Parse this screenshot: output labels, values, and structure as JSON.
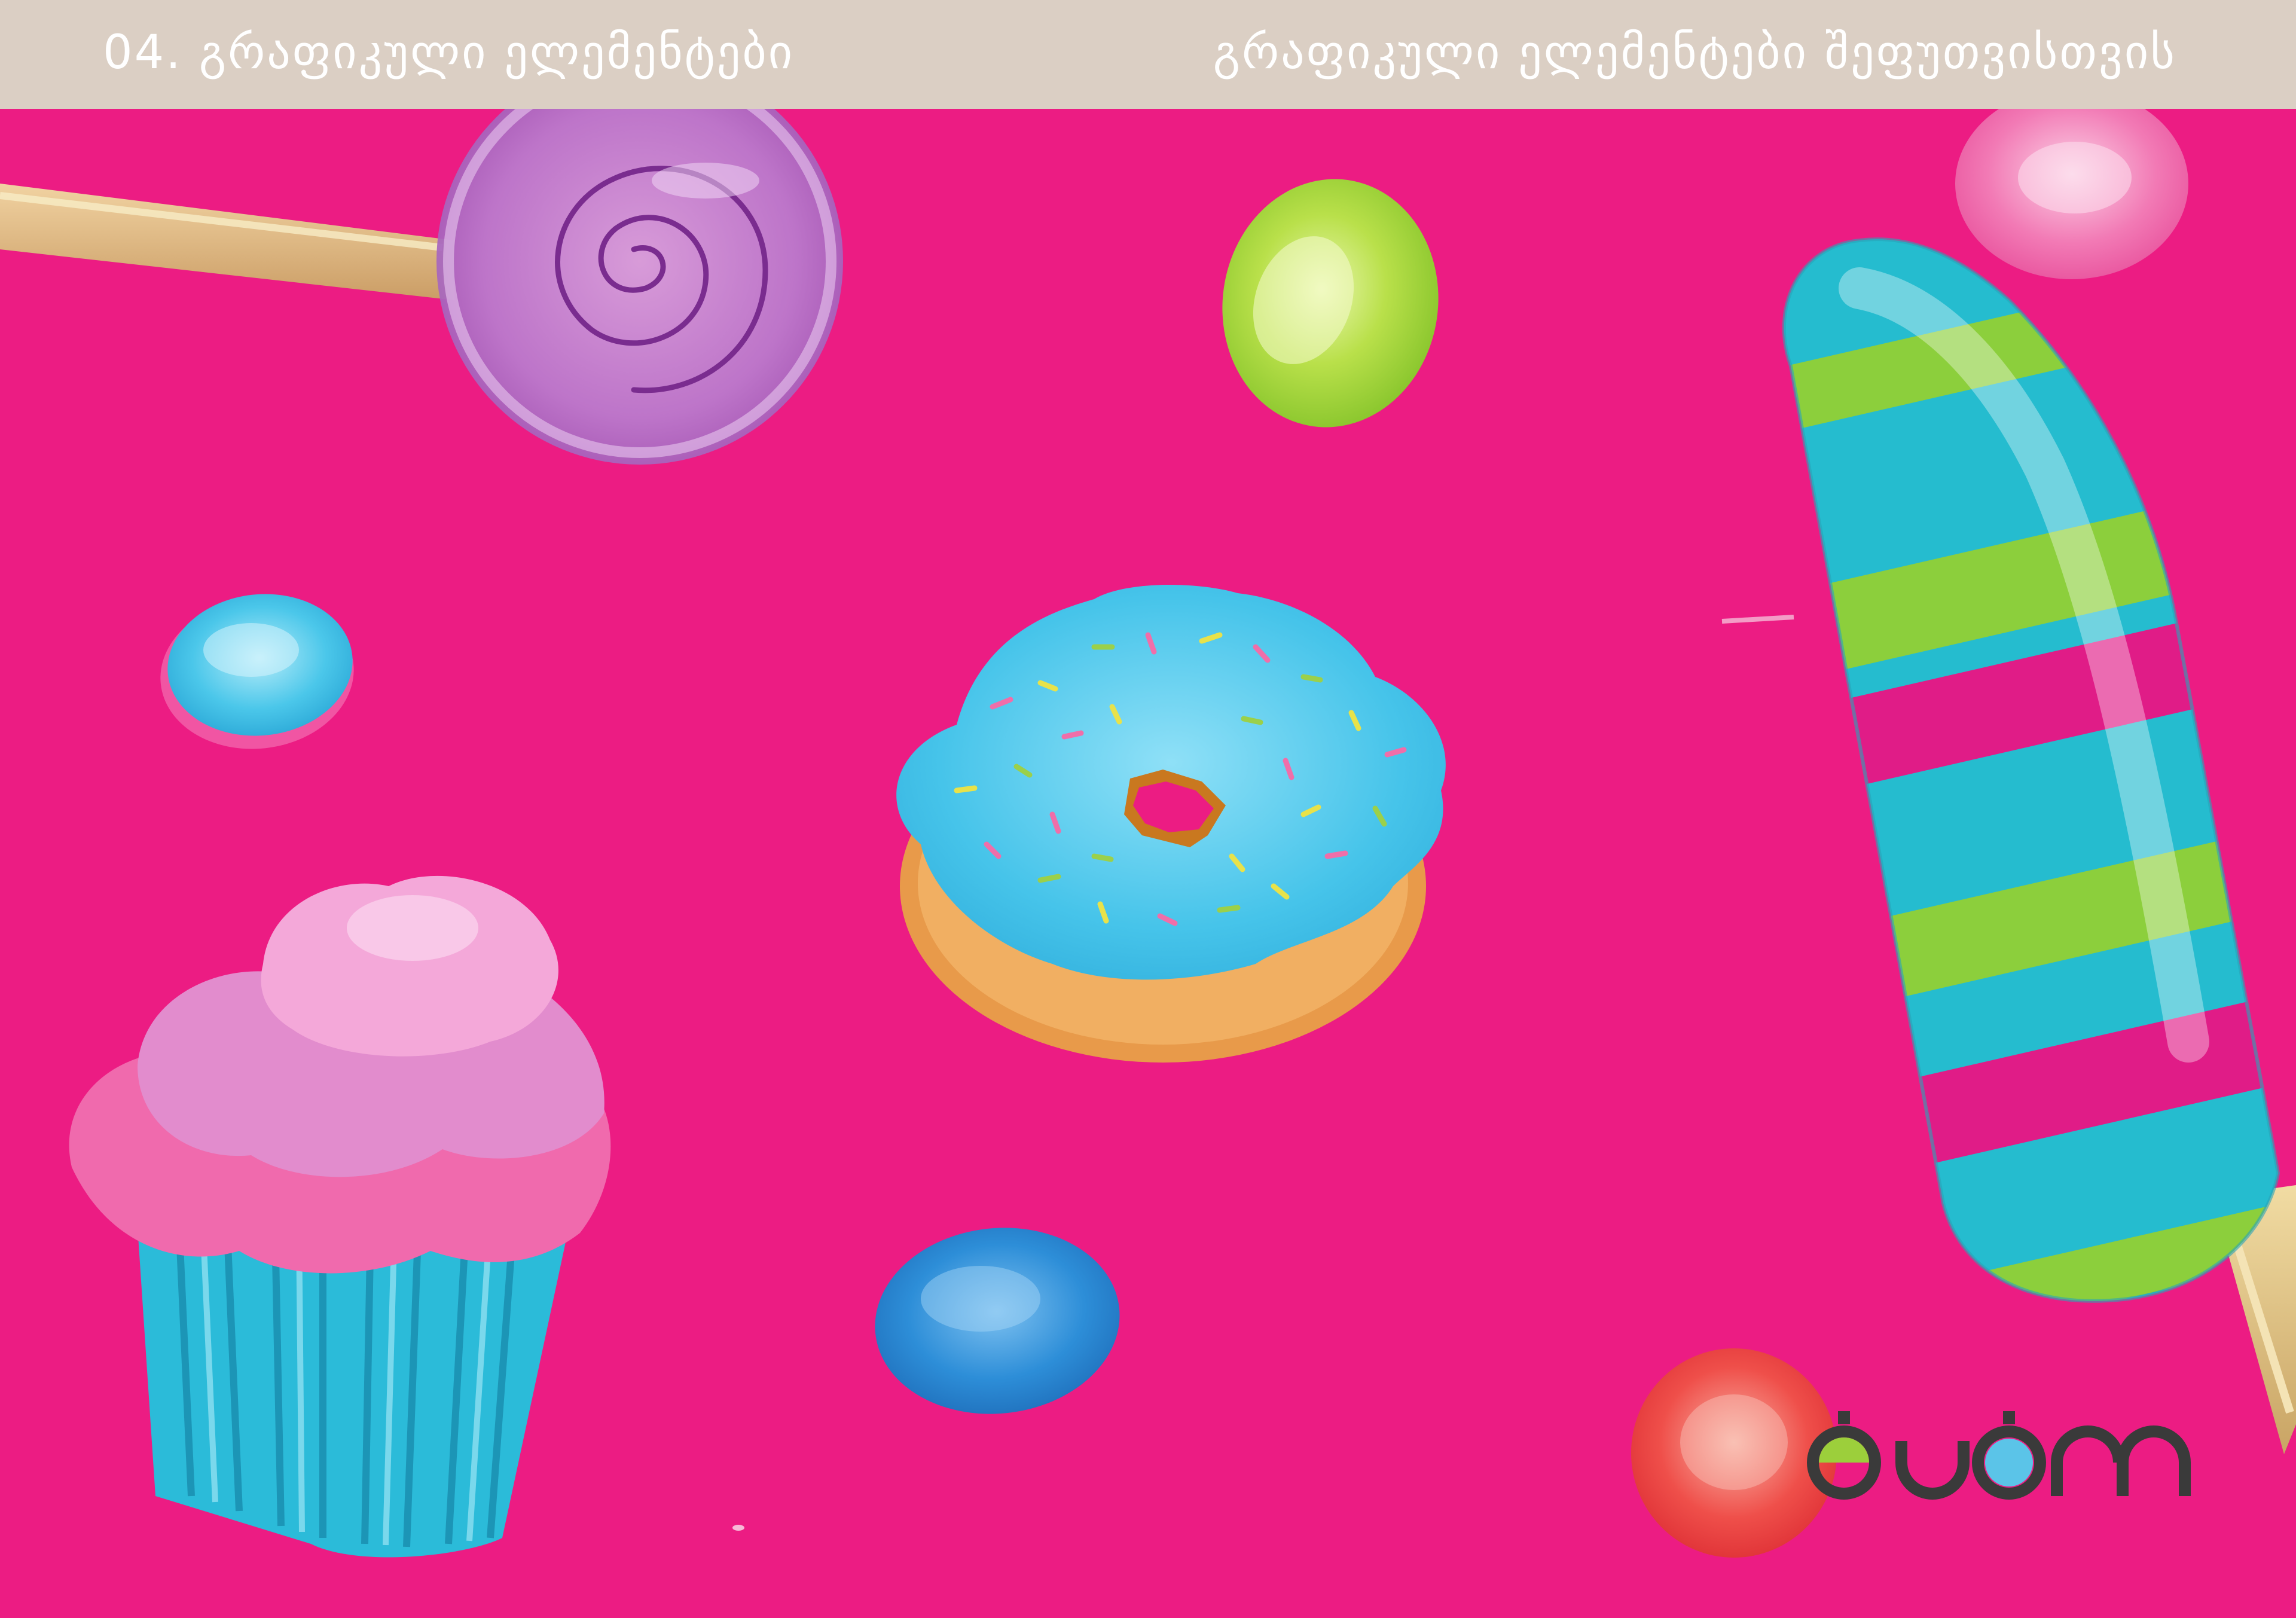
{
  "header": {
    "left_title": "04. გრაფიკული ელემენტები",
    "right_title": "გრაფიკული ელემენტები შეფუთვისთვის"
  },
  "colors": {
    "background": "#ec1c83",
    "header_band": "#dbcfc4",
    "header_text": "#ffffff",
    "logo_dark": "#3a3a3a",
    "logo_green": "#9ccf3b",
    "logo_blue": "#5bc4e8"
  },
  "illustrations": [
    "lollipop-icon",
    "green-candy-icon",
    "pink-candy-icon",
    "blue-candy-icon",
    "donut-icon",
    "popsicle-icon",
    "cupcake-icon",
    "dark-blue-candy-icon",
    "red-candy-icon"
  ],
  "logo": {
    "name": "brand-logo"
  }
}
